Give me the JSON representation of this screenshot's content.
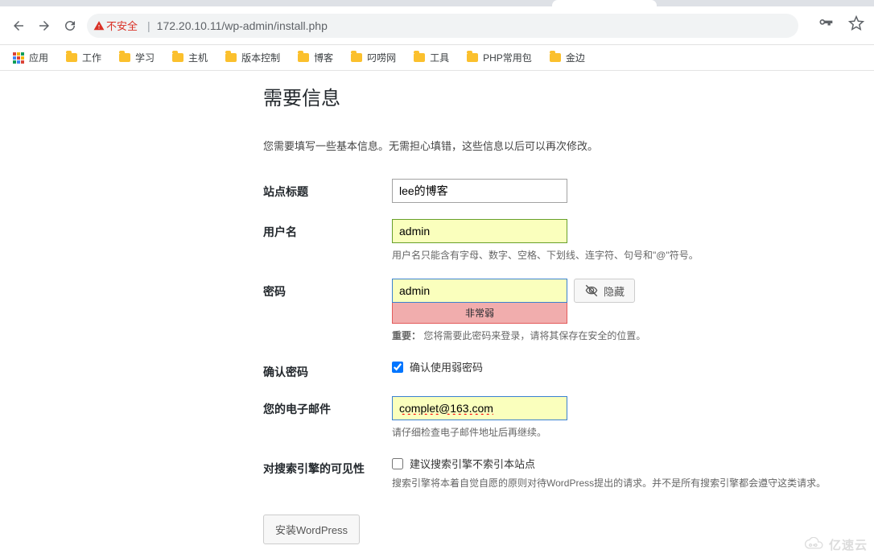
{
  "browser": {
    "insecure_label": "不安全",
    "url": "172.20.10.11/wp-admin/install.php"
  },
  "bookmarks": {
    "apps": "应用",
    "items": [
      "工作",
      "学习",
      "主机",
      "版本控制",
      "博客",
      "叼唠网",
      "工具",
      "PHP常用包",
      "金边"
    ]
  },
  "content": {
    "heading": "需要信息",
    "intro": "您需要填写一些基本信息。无需担心填错，这些信息以后可以再次修改。",
    "site_title_label": "站点标题",
    "site_title_value": "lee的博客",
    "username_label": "用户名",
    "username_value": "admin",
    "username_desc": "用户名只能含有字母、数字、空格、下划线、连字符、句号和\"@\"符号。",
    "password_label": "密码",
    "password_value": "admin",
    "password_strength": "非常弱",
    "hide_btn": "隐藏",
    "password_important_prefix": "重要：",
    "password_important_text": "您将需要此密码来登录，请将其保存在安全的位置。",
    "confirm_label": "确认密码",
    "confirm_checkbox": "确认使用弱密码",
    "email_label": "您的电子邮件",
    "email_value": "complet@163.com",
    "email_desc": "请仔细检查电子邮件地址后再继续。",
    "seo_label": "对搜索引擎的可见性",
    "seo_checkbox": "建议搜索引擎不索引本站点",
    "seo_desc": "搜索引擎将本着自觉自愿的原则对待WordPress提出的请求。并不是所有搜索引擎都会遵守这类请求。",
    "submit": "安装WordPress"
  },
  "watermark": "亿速云"
}
